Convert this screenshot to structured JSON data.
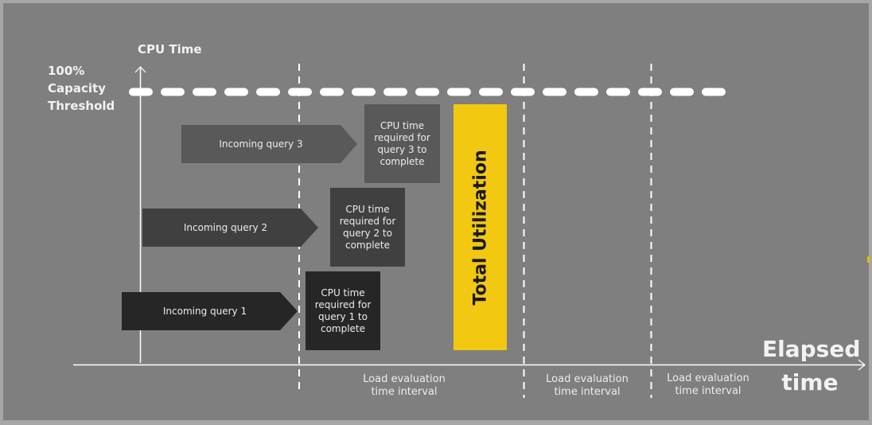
{
  "axes": {
    "y_title": "CPU Time",
    "x_title_line1": "Elapsed",
    "x_title_line2": "time",
    "threshold_line1": "100%",
    "threshold_line2": "Capacity",
    "threshold_line3": "Threshold"
  },
  "queries": [
    {
      "arrow_label": "Incoming query 1",
      "box_lines": [
        "CPU time",
        "required for",
        "query 1 to",
        "complete"
      ],
      "color": "#262626"
    },
    {
      "arrow_label": "Incoming query 2",
      "box_lines": [
        "CPU time",
        "required for",
        "query 2 to",
        "complete"
      ],
      "color": "#404040"
    },
    {
      "arrow_label": "Incoming query 3",
      "box_lines": [
        "CPU time",
        "required for",
        "query 3 to",
        "complete"
      ],
      "color": "#595959"
    }
  ],
  "utilization": {
    "label": "Total Utilization",
    "color": "#f2c811"
  },
  "intervals": [
    {
      "line1": "Load evaluation",
      "line2": "time interval"
    },
    {
      "line1": "Load evaluation",
      "line2": "time interval"
    },
    {
      "line1": "Load evaluation",
      "line2": "time interval"
    }
  ],
  "colors": {
    "background": "#7f7f7f",
    "border": "#a6a6a6",
    "lines": "#ffffff"
  }
}
